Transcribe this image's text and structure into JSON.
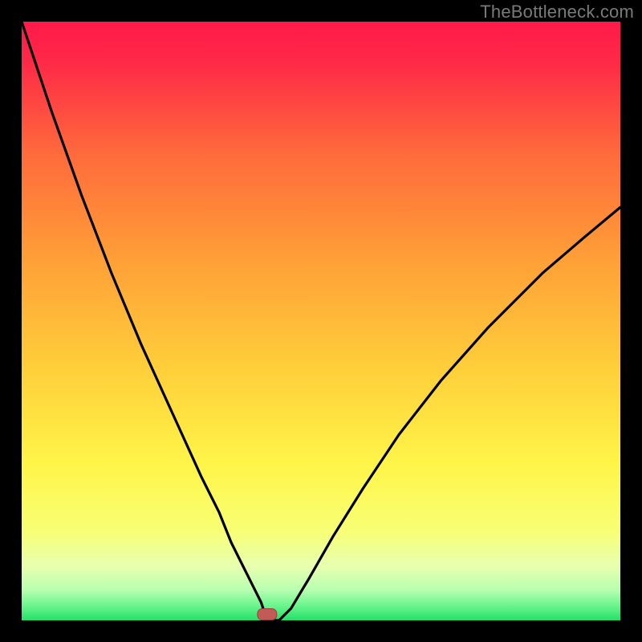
{
  "watermark": "TheBottleneck.com",
  "chart_data": {
    "type": "line",
    "title": "",
    "xlabel": "",
    "ylabel": "",
    "xlim": [
      0,
      100
    ],
    "ylim": [
      0,
      100
    ],
    "grid": false,
    "legend": false,
    "background_gradient": {
      "top_color": "#ff1a4a",
      "mid_color": "#ffd83a",
      "bottom_color": "#22e06a",
      "y_green_band_top": 96,
      "y_green_band_bottom": 100
    },
    "marker": {
      "x": 41,
      "y": 99,
      "shape": "rounded-rect",
      "color": "#c25a56"
    },
    "series": [
      {
        "name": "bottleneck-curve",
        "color": "#000000",
        "x": [
          0,
          5,
          10,
          15,
          20,
          25,
          30,
          33,
          35,
          37,
          39,
          40,
          41,
          42,
          43,
          45,
          48,
          52,
          57,
          63,
          70,
          78,
          87,
          94,
          100
        ],
        "values": [
          0,
          15,
          29,
          42,
          54,
          65,
          76,
          82,
          87,
          91,
          95,
          97,
          100,
          100,
          100,
          98,
          93,
          86,
          78,
          69,
          60,
          51,
          42,
          36,
          31
        ]
      }
    ],
    "notes": "y-axis inverted visually: 0 at top, 100 at bottom; values represent vertical position percentage from top of plot area"
  }
}
